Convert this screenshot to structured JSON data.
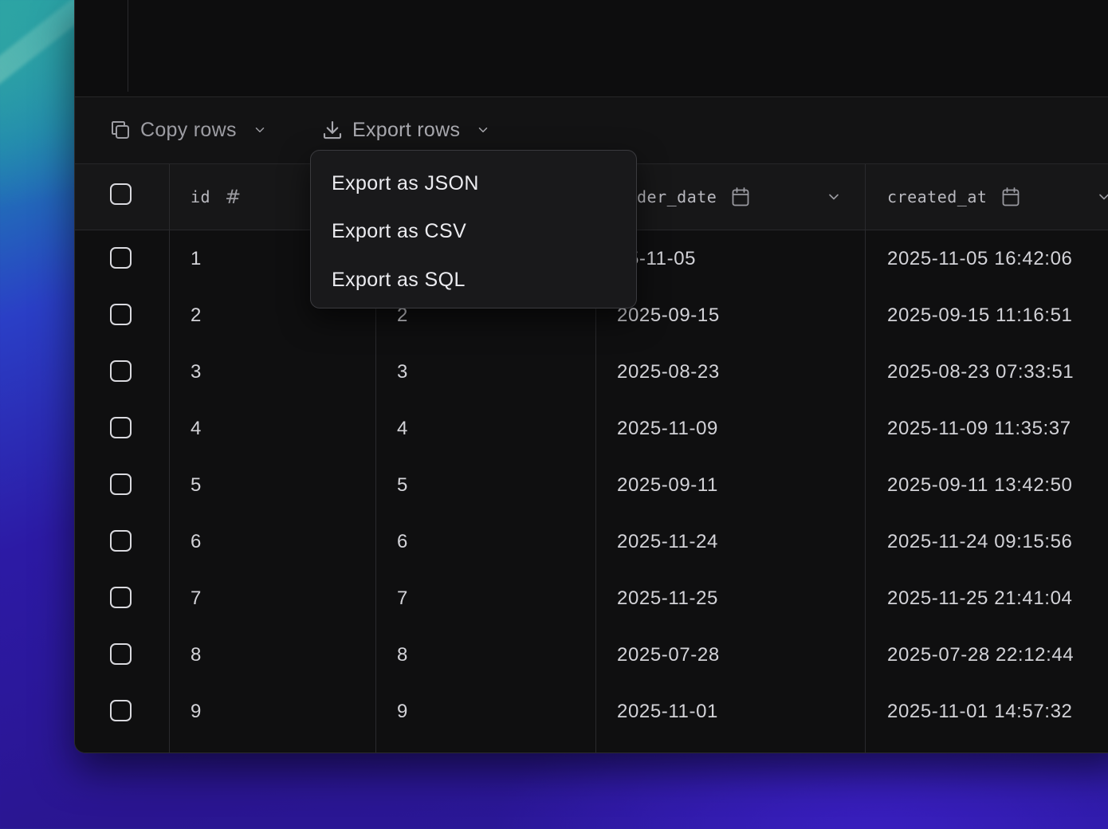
{
  "toolbar": {
    "copy_label": "Copy rows",
    "export_label": "Export rows",
    "copy_icon": "copy-icon",
    "export_icon": "download-icon"
  },
  "export_menu": {
    "items": [
      {
        "label": "Export as JSON"
      },
      {
        "label": "Export as CSV"
      },
      {
        "label": "Export as SQL"
      }
    ]
  },
  "table": {
    "columns": [
      {
        "name": "id",
        "type_icon": "#"
      },
      {
        "name": "",
        "type_icon": ""
      },
      {
        "name": "der_date",
        "type_icon": "calendar-icon"
      },
      {
        "name": "created_at",
        "type_icon": "calendar-icon"
      }
    ],
    "rows": [
      {
        "id": "1",
        "col2": "",
        "order_date": "25-11-05",
        "created_at": "2025-11-05 16:42:06"
      },
      {
        "id": "2",
        "col2": "2",
        "order_date": "2025-09-15",
        "created_at": "2025-09-15 11:16:51"
      },
      {
        "id": "3",
        "col2": "3",
        "order_date": "2025-08-23",
        "created_at": "2025-08-23 07:33:51"
      },
      {
        "id": "4",
        "col2": "4",
        "order_date": "2025-11-09",
        "created_at": "2025-11-09 11:35:37"
      },
      {
        "id": "5",
        "col2": "5",
        "order_date": "2025-09-11",
        "created_at": "2025-09-11 13:42:50"
      },
      {
        "id": "6",
        "col2": "6",
        "order_date": "2025-11-24",
        "created_at": "2025-11-24 09:15:56"
      },
      {
        "id": "7",
        "col2": "7",
        "order_date": "2025-11-25",
        "created_at": "2025-11-25 21:41:04"
      },
      {
        "id": "8",
        "col2": "8",
        "order_date": "2025-07-28",
        "created_at": "2025-07-28 22:12:44"
      },
      {
        "id": "9",
        "col2": "9",
        "order_date": "2025-11-01",
        "created_at": "2025-11-01 14:57:32"
      }
    ]
  },
  "colors": {
    "background": "#0f0f10",
    "header": "#171718",
    "menu": "#19191b",
    "text": "#d3d3d8"
  }
}
